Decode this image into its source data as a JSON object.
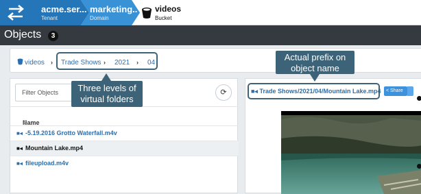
{
  "topbar": {
    "tenant": {
      "name": "acme.ser...",
      "label": "Tenant"
    },
    "domain": {
      "name": "marketing..",
      "label": "Domain"
    },
    "bucket": {
      "name": "videos",
      "label": "Bucket"
    },
    "colors": {
      "tenant_bg": "#2576b8",
      "domain_bg": "#3a92d6"
    }
  },
  "page": {
    "title": "Objects",
    "count": "3"
  },
  "breadcrumb": {
    "root": "videos",
    "items": [
      "Trade Shows",
      "2021",
      "04"
    ],
    "separator": "›"
  },
  "left_panel": {
    "filter_placeholder": "Filter Objects",
    "column_header": "Name",
    "sort_icon": "sort-icon",
    "rows": [
      {
        "name": "-5.19.2016 Grotto Waterfall.m4v",
        "icon": "video-icon",
        "selected": false
      },
      {
        "name": "Mountain Lake.mp4",
        "icon": "video-icon",
        "selected": true
      },
      {
        "name": "fileupload.m4v",
        "icon": "video-icon",
        "selected": false
      }
    ]
  },
  "right_panel": {
    "object_name": "Trade Shows/2021/04/Mountain Lake.mp4",
    "share_label": "Share"
  },
  "annotations": {
    "left_callout_line1": "Three levels of",
    "left_callout_line2": "virtual folders",
    "right_callout_line1": "Actual prefix on",
    "right_callout_line2": "object name",
    "color": "#3d6378"
  }
}
